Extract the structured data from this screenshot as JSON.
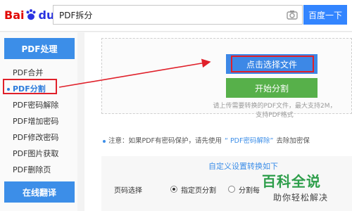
{
  "header": {
    "logo": {
      "bai": "Bai",
      "du": "du",
      "cn": "百度"
    },
    "search_value": "PDF拆分",
    "search_button": "百度一下"
  },
  "sidebar": {
    "title": "PDF处理",
    "items": [
      {
        "label": "PDF合并",
        "active": false
      },
      {
        "label": "PDF分割",
        "active": true
      },
      {
        "label": "PDF密码解除",
        "active": false
      },
      {
        "label": "PDF增加密码",
        "active": false
      },
      {
        "label": "PDF修改密码",
        "active": false
      },
      {
        "label": "PDF图片获取",
        "active": false
      },
      {
        "label": "PDF删除页",
        "active": false
      }
    ],
    "footer": "在线翻译"
  },
  "main": {
    "select_file": "点击选择文件",
    "start_split": "开始分割",
    "hint_line1": "请上传需要转换的PDF文件，最大支持2M，",
    "hint_line2": "支持PDF格式",
    "notice_prefix": "注意：如果PDF有密码保护，请先使用",
    "notice_link": "“ PDF密码解除”",
    "notice_suffix": "去除加密保",
    "settings_title": "自定义设置转换如下",
    "page_select_label": "页码选择",
    "option_specified": "指定页分割",
    "option_every": "分割每"
  },
  "watermark": {
    "main": "百科全说",
    "sub": "助你轻松解决"
  },
  "colors": {
    "accent_blue": "#3c8ee8",
    "search_blue": "#3385ff",
    "start_green": "#57b04a",
    "annotation_red": "#e0202a",
    "watermark_green": "#2d9e4a"
  }
}
